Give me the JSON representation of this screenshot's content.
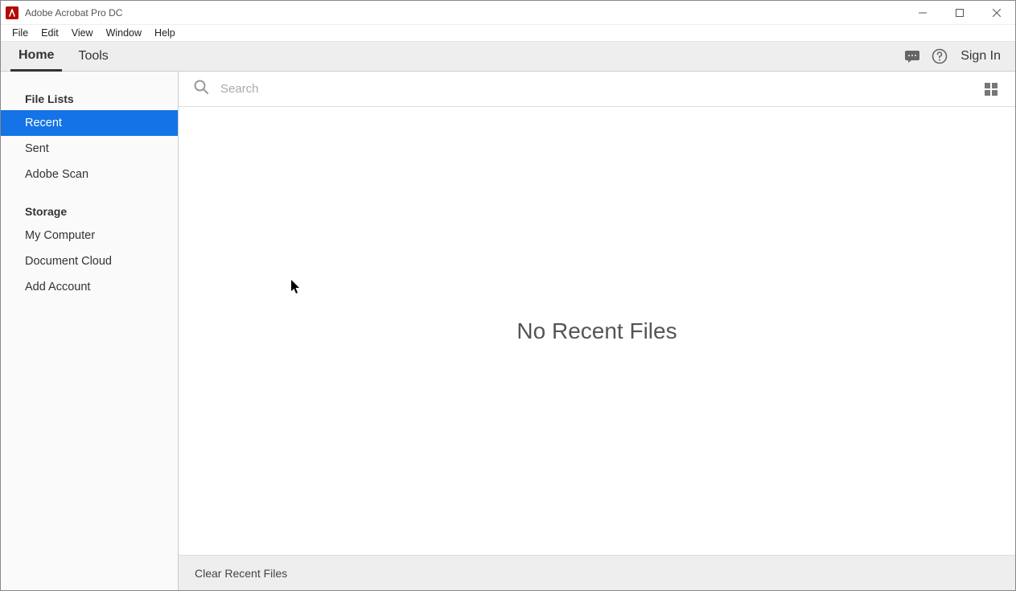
{
  "window": {
    "title": "Adobe Acrobat Pro DC"
  },
  "menubar": {
    "items": [
      "File",
      "Edit",
      "View",
      "Window",
      "Help"
    ]
  },
  "tabs": {
    "home": "Home",
    "tools": "Tools",
    "signin": "Sign In"
  },
  "sidebar": {
    "file_lists_header": "File Lists",
    "file_lists": {
      "recent": "Recent",
      "sent": "Sent",
      "adobe_scan": "Adobe Scan"
    },
    "storage_header": "Storage",
    "storage": {
      "my_computer": "My Computer",
      "document_cloud": "Document Cloud",
      "add_account": "Add Account"
    }
  },
  "search": {
    "placeholder": "Search"
  },
  "main": {
    "empty_message": "No Recent Files"
  },
  "footer": {
    "clear_recent": "Clear Recent Files"
  }
}
